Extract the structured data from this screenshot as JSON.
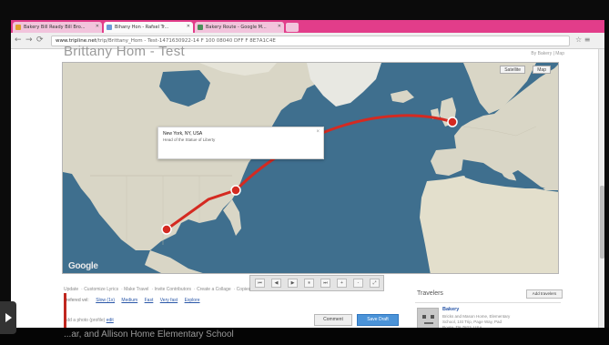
{
  "browser": {
    "tabs": [
      {
        "label": "Bakery Bill Ready Bill Bro..."
      },
      {
        "label": "Bihany Hon - Rafsel Tr..."
      },
      {
        "label": "Bakery Route - Google M..."
      }
    ],
    "nav": {
      "back": "←",
      "forward": "→",
      "reload": "⟳"
    },
    "address": {
      "host": "www.tripline.net",
      "path": "/trip/Brittany_Hom - Test-1471630922-14 F 100 08040 DFF F 8E7A1C4E"
    },
    "toolbar_right": "☆ ≡"
  },
  "page": {
    "title": "Brittany Hom - Test",
    "top_right": "By Bakery  | Map",
    "map": {
      "ctrl_map": "Map",
      "ctrl_satellite": "Satellite",
      "popup": {
        "place": "New York, NY, USA",
        "sub": "Head of the Statue of Liberty",
        "close": "×"
      },
      "google_logo": "Google"
    },
    "media_controls": [
      "⏮",
      "◀",
      "▶",
      "⏸",
      "⏭",
      "+",
      "-",
      "⤢"
    ],
    "links": [
      "Update",
      "Customize Lyrics",
      "Make Travel",
      "Invite Contributors",
      "Create a Collage",
      "Copies"
    ],
    "speed": {
      "label": "prefered vel:",
      "options": [
        "Slow (1x)",
        "Medium",
        "Fast",
        "Very fast",
        "Explore"
      ]
    },
    "edit_prompt": {
      "text": "Add a photo (profile)",
      "link": "edit"
    },
    "buttons": {
      "comment": "Comment",
      "save": "Save Draft"
    },
    "sidebar": {
      "title": "Travelers",
      "add_button": "Add travelers",
      "traveler_name": "Bakery",
      "traveler_addr": "Bricks and Mason Home, Elementary School, 1St Trip, Page Way, Pad Route, TN 7823, USA"
    }
  },
  "video": {
    "caption": "...ar, and Allison Home Elementary School"
  }
}
